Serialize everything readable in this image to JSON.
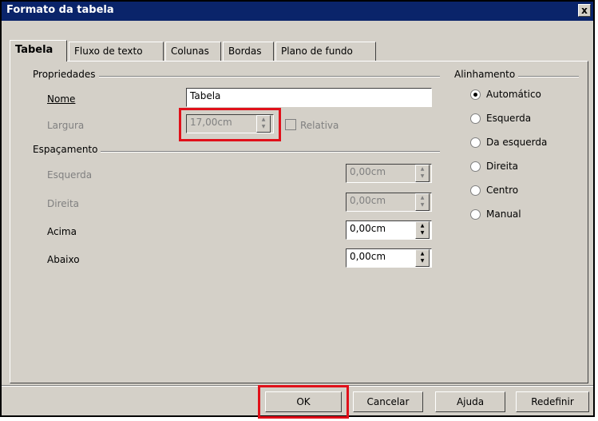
{
  "window": {
    "title": "Formato da tabela",
    "close_label": "x"
  },
  "tabs": [
    {
      "label": "Tabela",
      "active": true
    },
    {
      "label": "Fluxo de texto"
    },
    {
      "label": "Colunas"
    },
    {
      "label": "Bordas"
    },
    {
      "label": "Plano de fundo"
    }
  ],
  "propriedades": {
    "section_label": "Propriedades",
    "nome_label": "Nome",
    "nome_value": "Tabela",
    "largura_label": "Largura",
    "largura_value": "17,00cm",
    "relativa_label": "Relativa"
  },
  "espacamento": {
    "section_label": "Espaçamento",
    "esquerda_label": "Esquerda",
    "esquerda_value": "0,00cm",
    "direita_label": "Direita",
    "direita_value": "0,00cm",
    "acima_label": "Acima",
    "acima_value": "0,00cm",
    "abaixo_label": "Abaixo",
    "abaixo_value": "0,00cm"
  },
  "alinhamento": {
    "section_label": "Alinhamento",
    "options": [
      "Automático",
      "Esquerda",
      "Da esquerda",
      "Direita",
      "Centro",
      "Manual"
    ],
    "selected": "Automático"
  },
  "buttons": {
    "ok": "OK",
    "cancel": "Cancelar",
    "help": "Ajuda",
    "reset": "Redefinir"
  },
  "colors": {
    "highlight": "#e0101a",
    "titlebar": "#0a246a",
    "face": "#d4d0c8"
  }
}
